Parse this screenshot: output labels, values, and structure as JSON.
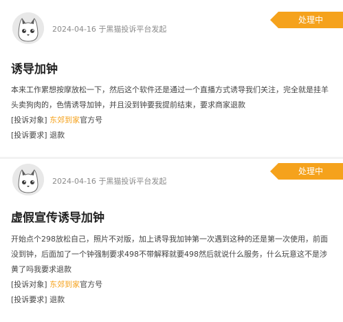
{
  "colors": {
    "accent": "#f5a21c",
    "badge_text": "#ffffff",
    "link": "#f5a21c"
  },
  "complaints": [
    {
      "avatar_icon": "cat-avatar-icon",
      "date": "2024-04-16",
      "source": "于黑猫投诉平台发起",
      "status": "处理中",
      "title": "诱导加钟",
      "content": "本来工作累想按摩放松一下，然后这个软件还是通过一个直播方式诱导我们关注，完全就是挂羊头卖狗肉的，色情诱导加钟，并且没到钟要我提前结束，要求商家退款",
      "target_label": "[投诉对象]",
      "target_link": "东郊到家",
      "target_suffix": "官方号",
      "request_label": "[投诉要求]",
      "request_value": "退款"
    },
    {
      "avatar_icon": "cat-avatar-icon",
      "date": "2024-04-16",
      "source": "于黑猫投诉平台发起",
      "status": "处理中",
      "title": "虚假宣传诱导加钟",
      "content": "开始点个298放松自己，照片不对版，加上诱导我加钟第一次遇到这种的还是第一次使用，前面没到钟，后面加了一个钟强制要求498不带解释就要498然后就说什么服务，什么玩意这不是涉黄了吗我要求退款",
      "target_label": "[投诉对象]",
      "target_link": "东郊到家",
      "target_suffix": "官方号",
      "request_label": "[投诉要求]",
      "request_value": "退款"
    }
  ]
}
